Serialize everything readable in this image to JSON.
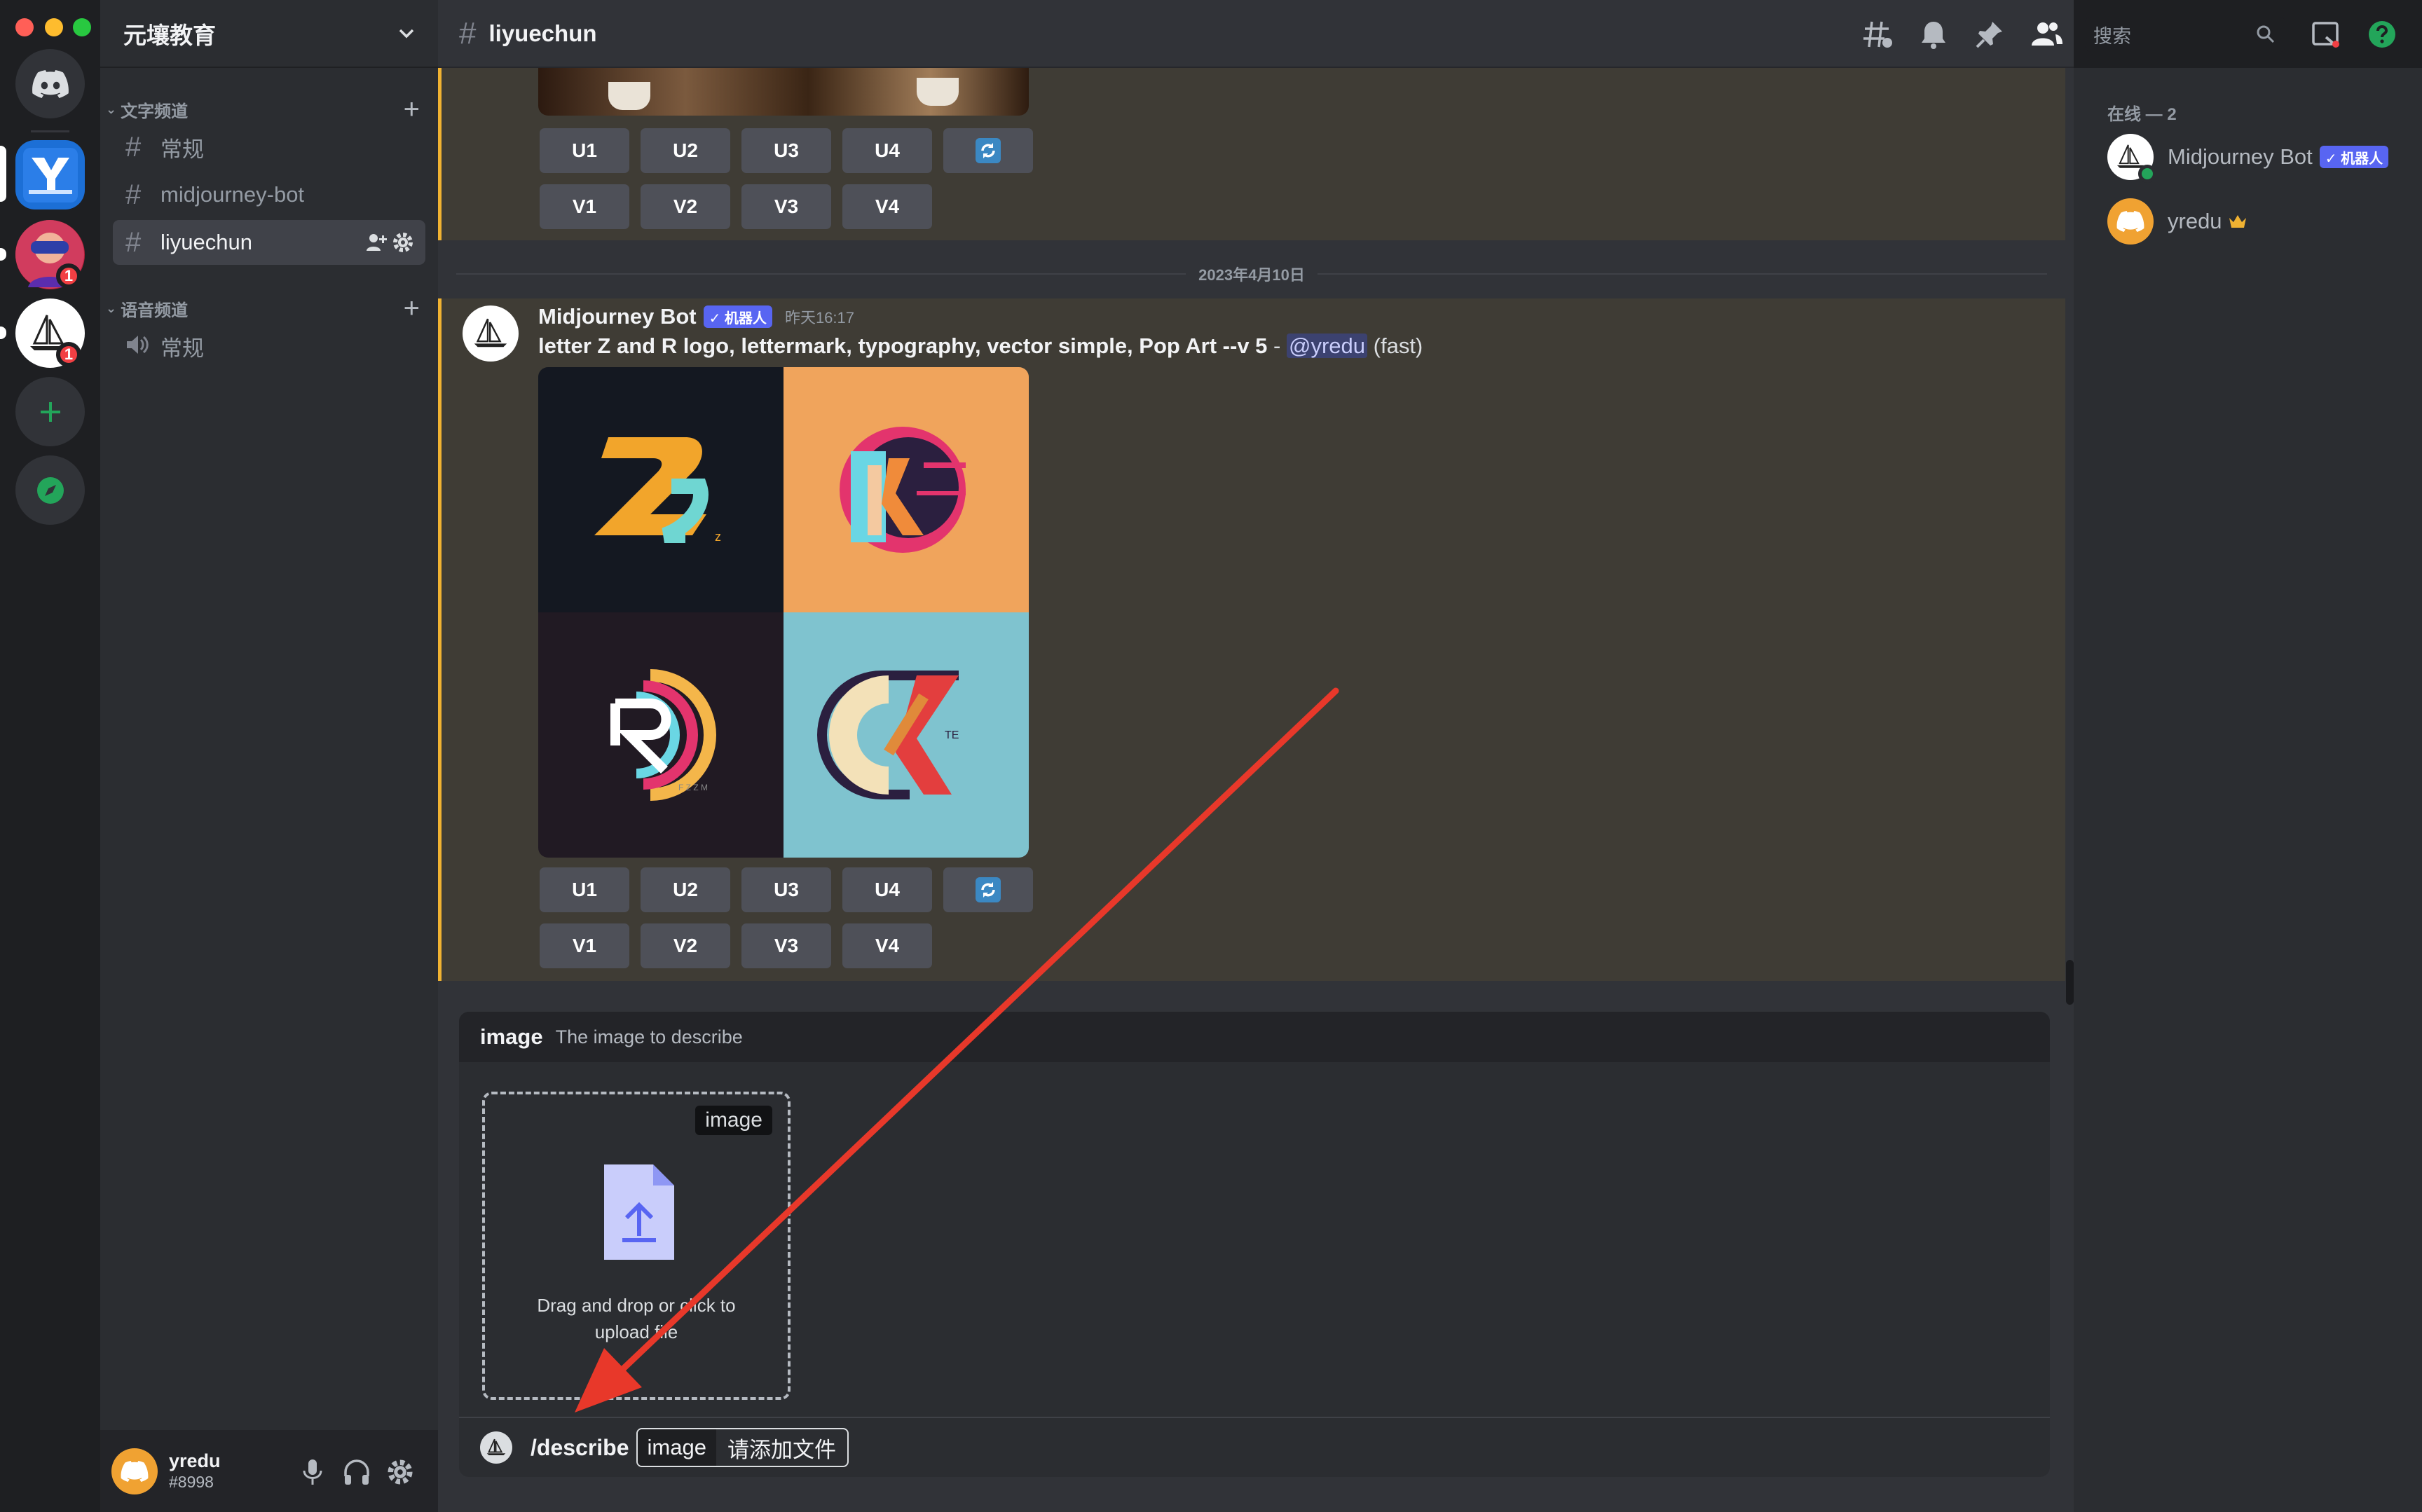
{
  "server": {
    "name": "元壤教育",
    "servers": [
      {
        "name": "Direct Messages"
      },
      {
        "name": "元壤教育",
        "badge": ""
      },
      {
        "name": "VR server",
        "badge": "1"
      },
      {
        "name": "Midjourney",
        "badge": "1"
      },
      {
        "name": "Add a Server"
      },
      {
        "name": "Explore Discoverable Servers"
      }
    ]
  },
  "sidebar": {
    "text_category": "文字频道",
    "voice_category": "语音频道",
    "text_channels": [
      {
        "label": "常规"
      },
      {
        "label": "midjourney-bot"
      },
      {
        "label": "liyuechun"
      }
    ],
    "voice_channels": [
      {
        "label": "常规"
      }
    ]
  },
  "user": {
    "name": "yredu",
    "tag": "#8998"
  },
  "topbar": {
    "channel": "liyuechun",
    "search_placeholder": "搜索"
  },
  "messages": {
    "prev_buttons_u": [
      "U1",
      "U2",
      "U3",
      "U4"
    ],
    "prev_buttons_v": [
      "V1",
      "V2",
      "V3",
      "V4"
    ],
    "date_divider": "2023年4月10日",
    "author": "Midjourney Bot",
    "bot_tag": "✓ 机器人",
    "timestamp": "昨天16:17",
    "prompt": "letter Z and R logo, lettermark, typography, vector simple, Pop Art --v 5",
    "separator": " - ",
    "mention": "@yredu",
    "mode": "(fast)",
    "buttons_u": [
      "U1",
      "U2",
      "U3",
      "U4"
    ],
    "buttons_v": [
      "V1",
      "V2",
      "V3",
      "V4"
    ]
  },
  "option": {
    "name": "image",
    "description": "The image to describe",
    "dropzone_tag": "image",
    "dropzone_line1": "Drag and drop or click to",
    "dropzone_line2": "upload file"
  },
  "composer": {
    "command": "/describe",
    "chip_key": "image",
    "chip_value": "请添加文件"
  },
  "members": {
    "heading": "在线 — 2",
    "list": [
      {
        "name": "Midjourney Bot",
        "tag": "✓ 机器人"
      },
      {
        "name": "yredu"
      }
    ]
  },
  "colors": {
    "accent": "#5865f2",
    "highlight_border": "#f0b232",
    "arrow": "#e8382a",
    "online": "#23a55a"
  }
}
